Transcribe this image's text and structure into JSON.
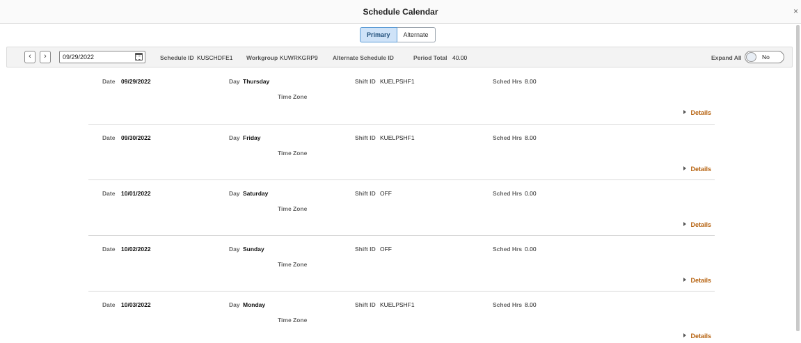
{
  "window": {
    "title": "Schedule Calendar",
    "close_glyph": "×"
  },
  "segment": {
    "primary_label": "Primary",
    "alternate_label": "Alternate",
    "selected": "Primary"
  },
  "toolbar": {
    "prev_icon": "chevron-left-icon",
    "next_icon": "chevron-right-icon",
    "date_value": "09/29/2022",
    "schedule_id_label": "Schedule ID",
    "schedule_id_value": "KUSCHDFE1",
    "workgroup_label": "Workgroup",
    "workgroup_value": "KUWRKGRP9",
    "alternate_schedule_label": "Alternate Schedule ID",
    "period_total_label": "Period Total",
    "period_total_value": "40.00",
    "expand_all_label": "Expand All",
    "expand_all_value": "No"
  },
  "labels": {
    "date": "Date",
    "day": "Day",
    "shift_id": "Shift ID",
    "sched_hrs": "Sched Hrs",
    "time_zone": "Time Zone",
    "details": "Details"
  },
  "rows": [
    {
      "date": "09/29/2022",
      "day": "Thursday",
      "shift_id": "KUELPSHF1",
      "sched_hrs": "8.00"
    },
    {
      "date": "09/30/2022",
      "day": "Friday",
      "shift_id": "KUELPSHF1",
      "sched_hrs": "8.00"
    },
    {
      "date": "10/01/2022",
      "day": "Saturday",
      "shift_id": "OFF",
      "sched_hrs": "0.00"
    },
    {
      "date": "10/02/2022",
      "day": "Sunday",
      "shift_id": "OFF",
      "sched_hrs": "0.00"
    },
    {
      "date": "10/03/2022",
      "day": "Monday",
      "shift_id": "KUELPSHF1",
      "sched_hrs": "8.00"
    }
  ],
  "colors": {
    "accent": "#b5600c",
    "selected_tab": "#cfe3f8"
  }
}
